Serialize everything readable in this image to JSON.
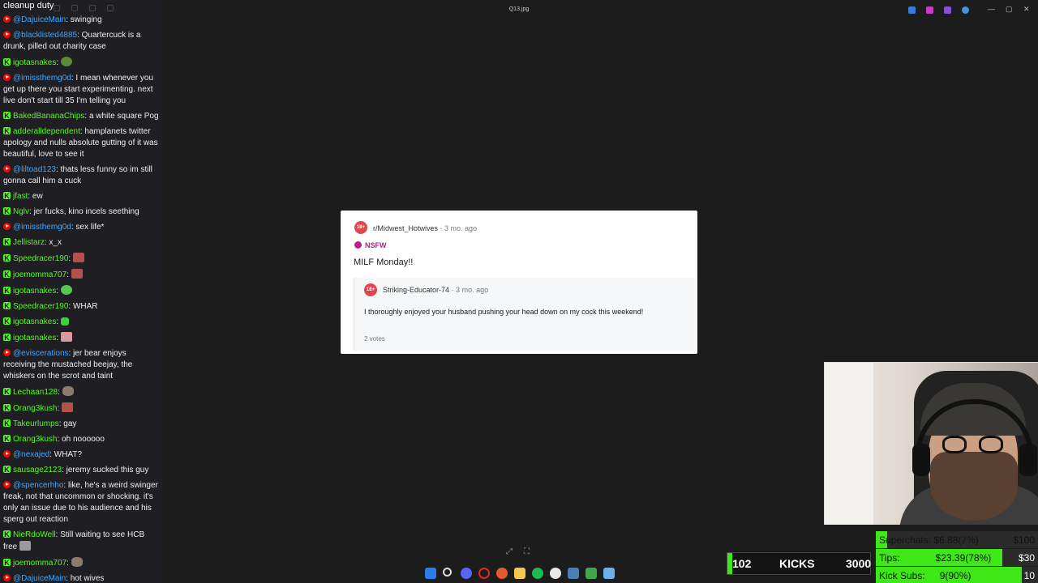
{
  "window": {
    "title": "Q13.jpg"
  },
  "chat": {
    "header": "cleanup duty",
    "messages": [
      {
        "platform": "yt",
        "user": "@DajuiceMain",
        "text": "swinging"
      },
      {
        "platform": "yt",
        "user": "@blacklisted4885",
        "text": "Quartercuck is a drunk, pilled out charity case"
      },
      {
        "platform": "kick",
        "user": "igotasnakes",
        "text": "",
        "emote": "pepe"
      },
      {
        "platform": "yt",
        "user": "@imissthemg0d",
        "text": "I mean whenever you get up there you start experimenting. next live don't start till 35 I'm telling you"
      },
      {
        "platform": "kick",
        "user": "BakedBananaChips",
        "text": "a white square Pog"
      },
      {
        "platform": "kick",
        "user": "adderalldependent",
        "text": "hamplanets twitter apology and nulls absolute gutting of it was beautiful, love to see it"
      },
      {
        "platform": "yt",
        "user": "@liltoad123",
        "text": "thats less funny so im still gonna call him a cuck"
      },
      {
        "platform": "kick",
        "user": "jfast",
        "text": "ew"
      },
      {
        "platform": "kick",
        "user": "Nglv",
        "text": "jer fucks, kino incels seething"
      },
      {
        "platform": "yt",
        "user": "@imissthemg0d",
        "text": "sex life*"
      },
      {
        "platform": "kick",
        "user": "Jellistarz",
        "text": "x_x"
      },
      {
        "platform": "kick",
        "user": "Speedracer190",
        "text": "",
        "emote": "red"
      },
      {
        "platform": "kick",
        "user": "joemomma707",
        "text": "",
        "emote": "red"
      },
      {
        "platform": "kick",
        "user": "igotasnakes",
        "text": "",
        "emote": "green-o"
      },
      {
        "platform": "kick",
        "user": "Speedracer190",
        "text": "WHAR"
      },
      {
        "platform": "kick",
        "user": "igotasnakes",
        "text": "",
        "emote": "small-green"
      },
      {
        "platform": "kick",
        "user": "igotasnakes",
        "text": "",
        "emote": "pink"
      },
      {
        "platform": "yt",
        "user": "@eviscerations",
        "text": "jer bear enjoys receiving the mustached beejay, the whiskers on the scrot and taint"
      },
      {
        "platform": "kick",
        "user": "Lechaan128",
        "text": "",
        "emote": "face"
      },
      {
        "platform": "kick",
        "user": "Orang3kush",
        "text": "",
        "emote": "red"
      },
      {
        "platform": "kick",
        "user": "Takeurlumps",
        "text": "gay"
      },
      {
        "platform": "kick",
        "user": "Orang3kush",
        "text": "oh noooooo"
      },
      {
        "platform": "yt",
        "user": "@nexajed",
        "text": "WHAT?"
      },
      {
        "platform": "kick",
        "user": "sausage2123",
        "text": "jeremy sucked this guy"
      },
      {
        "platform": "yt",
        "user": "@spencerhho",
        "text": "like, he's a weird swinger freak, not that uncommon or shocking. it's only an issue due to his audience and his sperg out reaction"
      },
      {
        "platform": "kick",
        "user": "NieRdoWell",
        "text": "Still waiting to see HCB free",
        "emote": "gray"
      },
      {
        "platform": "kick",
        "user": "joemomma707",
        "text": "",
        "emote": "face"
      },
      {
        "platform": "yt",
        "user": "@DajuiceMain",
        "text": "hot wives"
      }
    ]
  },
  "post": {
    "badge": "18+",
    "subreddit": "r/Midwest_Hotwives",
    "time": "· 3 mo. ago",
    "nsfw": "NSFW",
    "title": "MILF Monday!!",
    "comment": {
      "user": "Striking-Educator-74",
      "time": "· 3 mo. ago",
      "text": "I thoroughly enjoyed your husband pushing your head down on my cock this weekend!",
      "votes": "2 votes"
    }
  },
  "stats": {
    "superchats": {
      "label": "Superchats: $6.88(7%)",
      "goal": "$100",
      "fraction": 0.07
    },
    "tips": {
      "label": "Tips:",
      "value": "$23.39(78%)",
      "goal": "$30",
      "fraction": 0.78
    },
    "kick_subs": {
      "label": "Kick Subs:",
      "value": "9(90%)",
      "goal": "10",
      "fraction": 0.9
    }
  },
  "kicks": {
    "count": "102",
    "label": "KICKS",
    "goal": "3000"
  },
  "colors": {
    "kick_green": "#53fc18",
    "yt_blue": "#3ea6ff",
    "yt_red": "#ff0000",
    "nsfw": "#c01a8f"
  }
}
